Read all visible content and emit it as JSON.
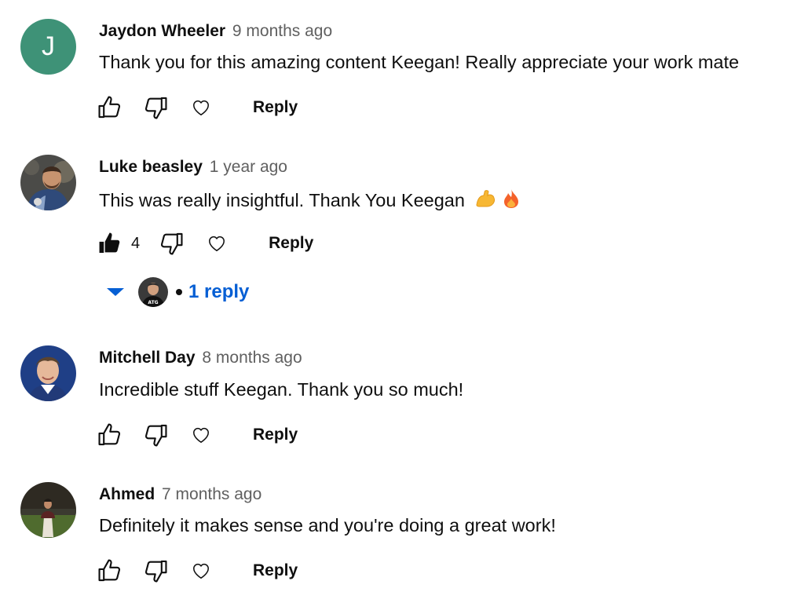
{
  "comments": [
    {
      "author": "Jaydon Wheeler",
      "time": "9 months ago",
      "text": "Thank you for this amazing content Keegan! Really appreciate your work mate",
      "avatar_letter": "J",
      "avatar_color": "#3e9277",
      "reply_label": "Reply",
      "liked": false
    },
    {
      "author": "Luke beasley",
      "time": "1 year ago",
      "text": "This was really insightful. Thank You Keegan",
      "emojis": [
        "flexed-biceps-emoji",
        "fire-emoji"
      ],
      "like_count": "4",
      "reply_label": "Reply",
      "liked": true,
      "replies": {
        "label": "1 reply",
        "replier_avatar_text": "ATG"
      }
    },
    {
      "author": "Mitchell Day",
      "time": "8 months ago",
      "text": "Incredible stuff Keegan. Thank you so much!",
      "reply_label": "Reply",
      "liked": false
    },
    {
      "author": "Ahmed",
      "time": "7 months ago",
      "text": "Definitely it makes sense and you're doing a great work!",
      "reply_label": "Reply",
      "liked": false
    }
  ],
  "colors": {
    "link_blue": "#065fd4",
    "meta_gray": "#606060",
    "text": "#0f0f0f"
  }
}
